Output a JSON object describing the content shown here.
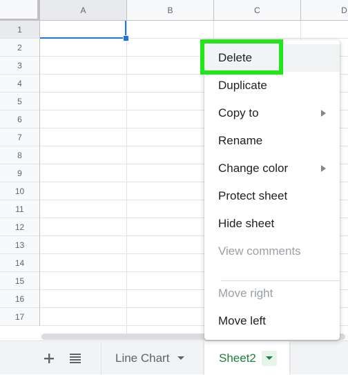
{
  "grid": {
    "columns": [
      "A",
      "B",
      "C",
      "D"
    ],
    "rows": [
      "1",
      "2",
      "3",
      "4",
      "5",
      "6",
      "7",
      "8",
      "9",
      "10",
      "11",
      "12",
      "13",
      "14",
      "15",
      "16",
      "17"
    ],
    "selected_cell": "A1",
    "selection_color": "#1a73e8"
  },
  "context_menu": {
    "items": [
      {
        "label": "Delete",
        "disabled": false,
        "submenu": false,
        "highlighted": true
      },
      {
        "label": "Duplicate",
        "disabled": false,
        "submenu": false
      },
      {
        "label": "Copy to",
        "disabled": false,
        "submenu": true
      },
      {
        "label": "Rename",
        "disabled": false,
        "submenu": false
      },
      {
        "label": "Change color",
        "disabled": false,
        "submenu": true
      },
      {
        "label": "Protect sheet",
        "disabled": false,
        "submenu": false
      },
      {
        "label": "Hide sheet",
        "disabled": false,
        "submenu": false
      },
      {
        "label": "View comments",
        "disabled": true,
        "submenu": false
      },
      {
        "label": "Move right",
        "disabled": true,
        "submenu": false
      },
      {
        "label": "Move left",
        "disabled": false,
        "submenu": false
      }
    ],
    "highlight_color": "#22e61a"
  },
  "tabbar": {
    "add_sheet_icon": "plus-icon",
    "all_sheets_icon": "list-icon",
    "tabs": [
      {
        "label": "Line Chart",
        "active": false
      },
      {
        "label": "Sheet2",
        "active": true
      }
    ],
    "active_color": "#188038"
  }
}
